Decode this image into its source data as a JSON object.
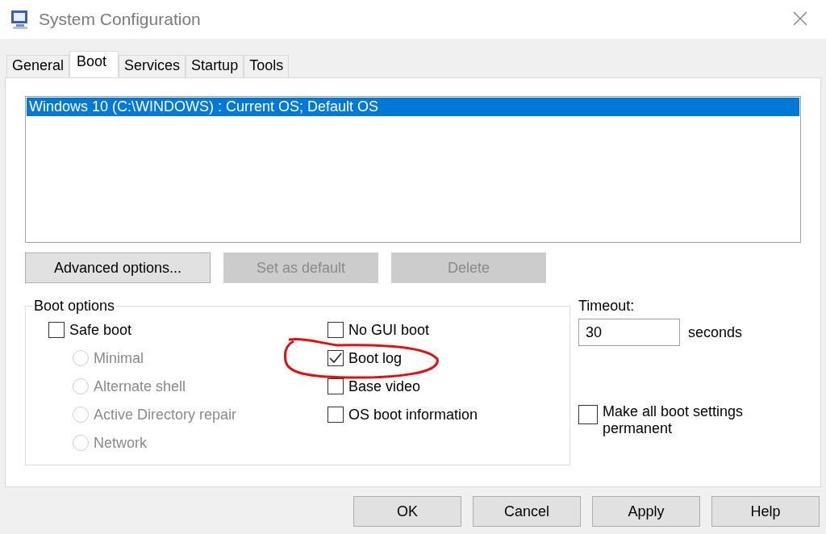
{
  "window": {
    "title": "System Configuration"
  },
  "tabs": [
    {
      "label": "General",
      "selected": false
    },
    {
      "label": "Boot",
      "selected": true
    },
    {
      "label": "Services",
      "selected": false
    },
    {
      "label": "Startup",
      "selected": false
    },
    {
      "label": "Tools",
      "selected": false
    }
  ],
  "os_list": [
    {
      "label": "Windows 10 (C:\\WINDOWS) : Current OS; Default OS",
      "selected": true
    }
  ],
  "list_buttons": [
    {
      "label": "Advanced options...",
      "disabled": false
    },
    {
      "label": "Set as default",
      "disabled": true
    },
    {
      "label": "Delete",
      "disabled": true
    }
  ],
  "boot_options": {
    "title": "Boot options",
    "left": [
      {
        "kind": "checkbox",
        "label": "Safe boot",
        "checked": false,
        "disabled": false
      },
      {
        "kind": "radio",
        "label": "Minimal",
        "selected": false,
        "disabled": true
      },
      {
        "kind": "radio",
        "label": "Alternate shell",
        "selected": false,
        "disabled": true
      },
      {
        "kind": "radio",
        "label": "Active Directory repair",
        "selected": false,
        "disabled": true
      },
      {
        "kind": "radio",
        "label": "Network",
        "selected": false,
        "disabled": true
      }
    ],
    "right": [
      {
        "label": "No GUI boot",
        "checked": false,
        "circled": false
      },
      {
        "label": "Boot log",
        "checked": true,
        "circled": true
      },
      {
        "label": "Base video",
        "checked": false,
        "circled": false
      },
      {
        "label": "OS boot information",
        "checked": false,
        "circled": false
      }
    ]
  },
  "timeout": {
    "label": "Timeout:",
    "value": "30",
    "unit": "seconds"
  },
  "permanent": {
    "label": "Make all boot settings permanent",
    "checked": false
  },
  "dialog_buttons": [
    "OK",
    "Cancel",
    "Apply",
    "Help"
  ]
}
